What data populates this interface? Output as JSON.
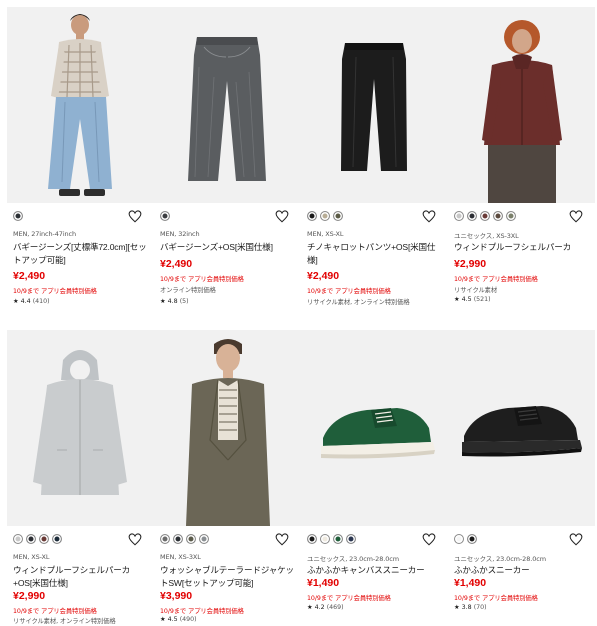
{
  "products": [
    {
      "meta": "MEN, 27inch-47inch",
      "name": "バギージーンズ[丈標準72.0cm][セットアップ可能]",
      "price": "¥2,490",
      "promo": "10/9まで アプリ会員特別価格",
      "notes": [],
      "rating_stars": "★",
      "rating_value": "4.4",
      "rating_count": "(410)",
      "swatches": [
        "#2b2f34"
      ],
      "image": "person-baggy-jeans"
    },
    {
      "meta": "MEN, 32inch",
      "name": "バギージーンズ+OS[米国仕様]",
      "price": "¥2,490",
      "promo": "10/9まで アプリ会員特別価格",
      "notes": [
        "オンライン特別価格"
      ],
      "rating_stars": "★",
      "rating_value": "4.8",
      "rating_count": "(5)",
      "swatches": [
        "#3b3d40"
      ],
      "image": "gray-jeans"
    },
    {
      "meta": "MEN, XS-XL",
      "name": "チノキャロットパンツ+OS[米国仕様]",
      "price": "¥2,490",
      "promo": "10/9まで アプリ会員特別価格",
      "notes": [
        "リサイクル素材, オンライン特別価格"
      ],
      "rating_stars": "",
      "rating_value": "",
      "rating_count": "",
      "swatches": [
        "#1a1a1a",
        "#b8ad95",
        "#5a5a45"
      ],
      "image": "black-pants"
    },
    {
      "meta": "ユニセックス, XS-3XL",
      "name": "ウィンドプルーフシェルパーカ",
      "price": "¥2,990",
      "promo": "10/9まで アプリ会員特別価格",
      "notes": [
        "リサイクル素材"
      ],
      "rating_stars": "★",
      "rating_value": "4.5",
      "rating_count": "(521)",
      "swatches": [
        "#c8c8c8",
        "#2b2d33",
        "#6a3a36",
        "#5b4a3e",
        "#7a7f6a"
      ],
      "image": "person-burgundy-parka"
    },
    {
      "meta": "MEN, XS-XL",
      "name": "ウィンドプルーフシェルパーカ+OS[米国仕様]",
      "price": "¥2,990",
      "promo": "10/9まで アプリ会員特別価格",
      "notes": [
        "リサイクル素材, オンライン特別価格"
      ],
      "rating_stars": "",
      "rating_value": "",
      "rating_count": "",
      "swatches": [
        "#c9c9c9",
        "#2b2d33",
        "#6a3a36",
        "#1b2a38"
      ],
      "image": "gray-parka"
    },
    {
      "meta": "MEN, XS-3XL",
      "name": "ウォッシャブルテーラードジャケットSW[セットアップ可能]",
      "price": "¥3,990",
      "promo": "10/9まで アプリ会員特別価格",
      "notes": [],
      "rating_stars": "★",
      "rating_value": "4.5",
      "rating_count": "(490)",
      "swatches": [
        "#6b6b6b",
        "#2b2f34",
        "#5a5a4a",
        "#8a8f93"
      ],
      "image": "person-tailored-jacket"
    },
    {
      "meta": "ユニセックス, 23.0cm-28.0cm",
      "name": "ふかふかキャンバススニーカー",
      "price": "¥1,490",
      "promo": "10/9まで アプリ会員特別価格",
      "notes": [],
      "rating_stars": "★",
      "rating_value": "4.2",
      "rating_count": "(469)",
      "swatches": [
        "#1a1a1a",
        "#efeae0",
        "#1f5e3a",
        "#2a3550"
      ],
      "image": "green-sneaker"
    },
    {
      "meta": "ユニセックス, 23.0cm-28.0cm",
      "name": "ふかふかスニーカー",
      "price": "¥1,490",
      "promo": "10/9まで アプリ会員特別価格",
      "notes": [],
      "rating_stars": "★",
      "rating_value": "3.8",
      "rating_count": "(70)",
      "swatches": [
        "#f5f5f5",
        "#1a1a1a"
      ],
      "image": "black-sneaker"
    }
  ],
  "colors": {
    "price": "#e20000",
    "image_bg": "#f2f2f2"
  }
}
